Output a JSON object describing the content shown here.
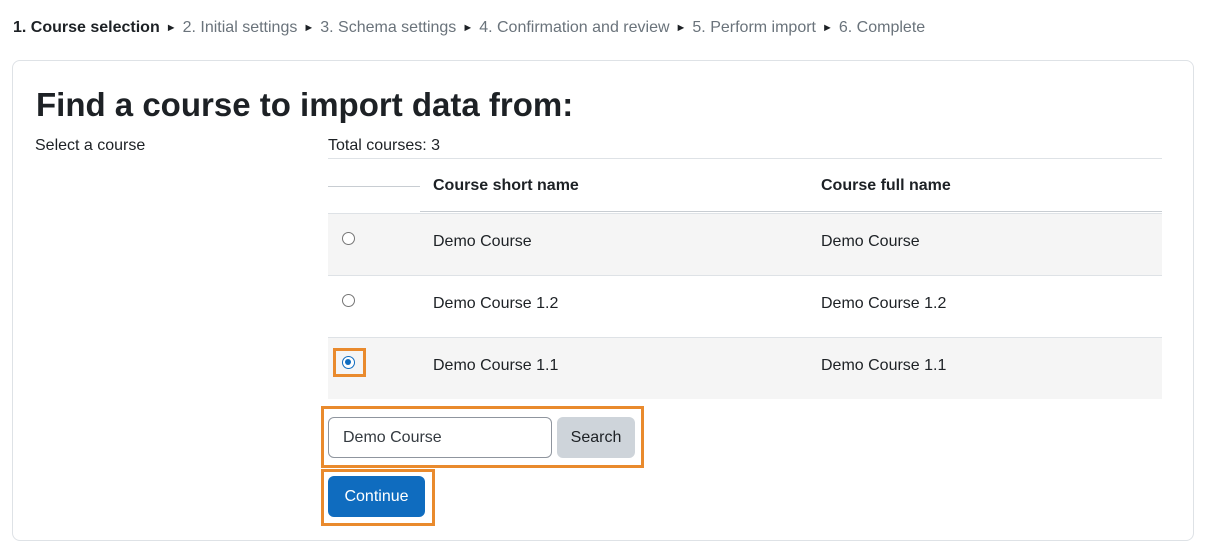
{
  "steps": [
    {
      "label": "1. Course selection",
      "active": true
    },
    {
      "label": "2. Initial settings",
      "active": false
    },
    {
      "label": "3. Schema settings",
      "active": false
    },
    {
      "label": "4. Confirmation and review",
      "active": false
    },
    {
      "label": "5. Perform import",
      "active": false
    },
    {
      "label": "6. Complete",
      "active": false
    }
  ],
  "step_separator": "►",
  "heading": "Find a course to import data from:",
  "select_label": "Select a course",
  "total_courses": "Total courses: 3",
  "table": {
    "headers": {
      "short_name": "Course short name",
      "full_name": "Course full name"
    },
    "rows": [
      {
        "short_name": "Demo Course",
        "full_name": "Demo Course",
        "selected": false
      },
      {
        "short_name": "Demo Course 1.2",
        "full_name": "Demo Course 1.2",
        "selected": false
      },
      {
        "short_name": "Demo Course 1.1",
        "full_name": "Demo Course 1.1",
        "selected": true
      }
    ]
  },
  "search": {
    "value": "Demo Course",
    "button_label": "Search"
  },
  "continue_label": "Continue",
  "colors": {
    "primary": "#0f6cbf",
    "highlight": "#e98a2d",
    "secondary_button": "#ced4da",
    "stripe": "#f5f5f5"
  }
}
